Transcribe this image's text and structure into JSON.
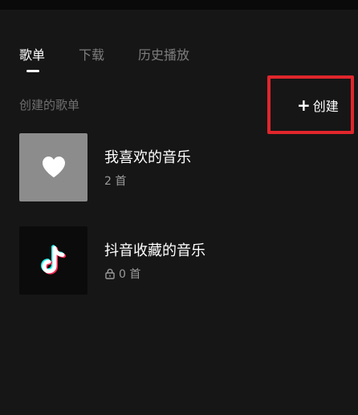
{
  "tabs": [
    {
      "label": "歌单",
      "active": true
    },
    {
      "label": "下载",
      "active": false
    },
    {
      "label": "历史播放",
      "active": false
    }
  ],
  "section": {
    "label": "创建的歌单",
    "create_label": "创建",
    "create_icon": "plus-icon"
  },
  "playlists": [
    {
      "title": "我喜欢的音乐",
      "count": "2 首",
      "cover_icon": "heart-icon"
    },
    {
      "title": "抖音收藏的音乐",
      "count": "0 首",
      "cover_icon": "tiktok-logo-icon",
      "status_icon": "lock-icon"
    }
  ],
  "colors": {
    "background": "#161616",
    "highlight": "#e0262c",
    "muted_text": "#7d7d7d"
  }
}
